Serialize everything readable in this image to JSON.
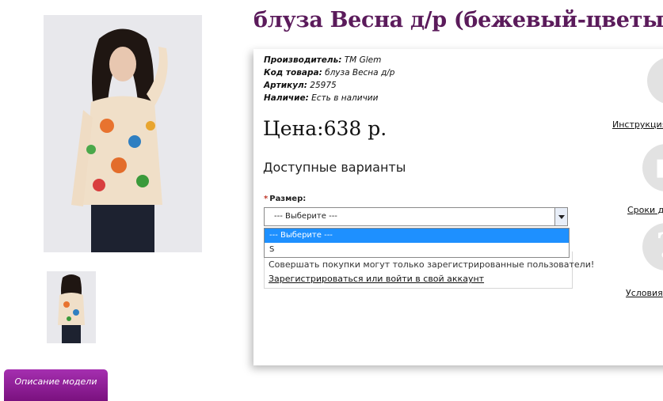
{
  "product": {
    "title": "блуза Весна д/р (бежевый-цветы)",
    "manufacturer_label": "Производитель:",
    "manufacturer_value": "TM Glem",
    "code_label": "Код товара:",
    "code_value": "блуза Весна д/р",
    "sku_label": "Артикул:",
    "sku_value": "25975",
    "availability_label": "Наличие:",
    "availability_value": "Есть в наличии",
    "price": "Цена:638 р."
  },
  "options": {
    "heading": "Доступные варианты",
    "size_label": "Размер:",
    "required_mark": "*",
    "selected": "--- Выберите ---",
    "dropdown_items": [
      "--- Выберите ---",
      "S"
    ]
  },
  "notice": {
    "text": "Совершать покупки могут только зарегистрированные пользователи!",
    "link": "Зарегистрироваться или войти в свой аккаунт"
  },
  "side": {
    "icons": [
      "info-icon",
      "truck-icon",
      "question-icon"
    ],
    "links": [
      "Инструкция",
      "Сроки до",
      "Условия"
    ]
  },
  "tabs": {
    "description": "Описание модели"
  },
  "colors": {
    "title": "#5b1b5b",
    "tab": "#8e1f96",
    "selected_option": "#1e90ff"
  }
}
